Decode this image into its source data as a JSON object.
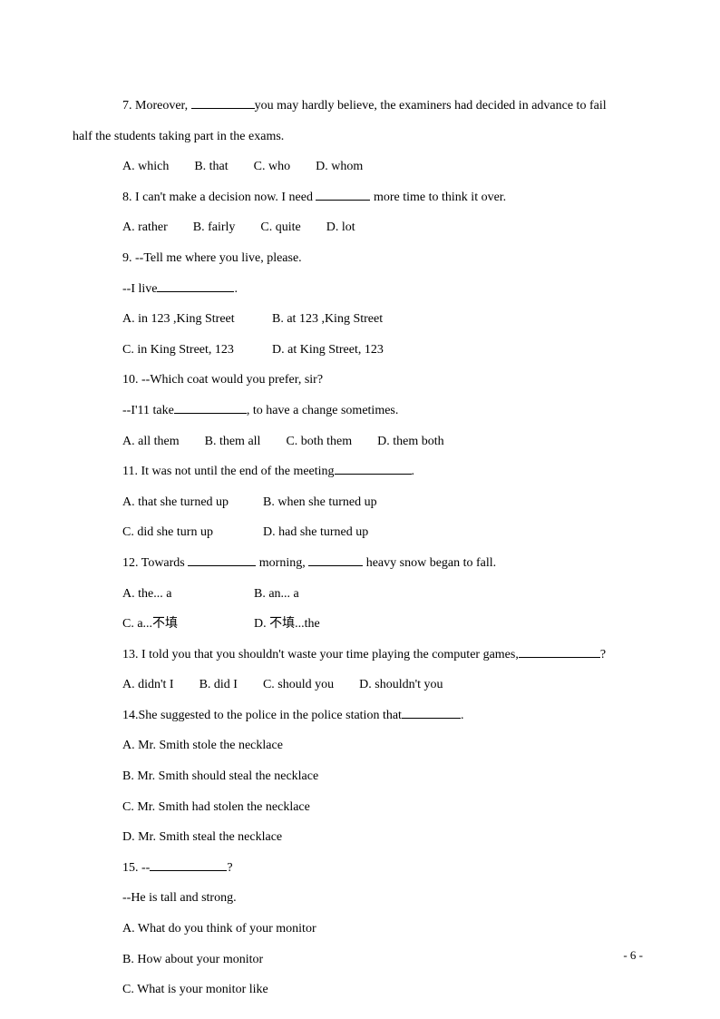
{
  "q7": {
    "pre": "7. Moreover, ",
    "post": "you may hardly believe, the examiners had decided in advance to fail",
    "cont": "half the students taking part in the exams.",
    "a": "A. which",
    "b": "B. that",
    "c": "C. who",
    "d": "D. whom"
  },
  "q8": {
    "pre": "8. I can't make a decision now. I need ",
    "post": " more time to think it over.",
    "a": "A. rather",
    "b": "B. fairly",
    "c": "C. quite",
    "d": "D. lot"
  },
  "q9": {
    "line1": "9. --Tell me where you live, please.",
    "line2": "--I live",
    "dot": ".",
    "a": "A. in 123 ,King Street",
    "b": "B. at 123 ,King Street",
    "c": "C. in King Street, 123",
    "d": "D. at King Street, 123"
  },
  "q10": {
    "line1": "10. --Which coat would you prefer, sir?",
    "pre": "--I'11 take",
    "post": ", to have a change sometimes.",
    "a": "A. all them",
    "b": "B. them all",
    "c": "C. both them",
    "d": "D. them both"
  },
  "q11": {
    "pre": "11. It was not until the end of the meeting",
    "dot": ".",
    "a": "A. that she turned up",
    "b": "B. when she turned up",
    "c": "C. did she turn up",
    "d": "D. had she turned up"
  },
  "q12": {
    "pre": "12. Towards ",
    "mid": " morning, ",
    "post": " heavy snow began to fall.",
    "a": "A. the... a",
    "b": "B. an... a",
    "c": "C. a...不填",
    "d": "D. 不填...the"
  },
  "q13": {
    "pre": "13. I told you that you shouldn't waste your time playing the computer games,",
    "post": "?",
    "a": "A. didn't I",
    "b": "B. did I",
    "c": "C. should you",
    "d": "D. shouldn't you"
  },
  "q14": {
    "pre": "14.She suggested to the police in the police station that",
    "dot": ".",
    "a": "A. Mr. Smith stole the necklace",
    "b": "B. Mr. Smith should steal the necklace",
    "c": "C. Mr. Smith had stolen the necklace",
    "d": "D. Mr. Smith steal the necklace"
  },
  "q15": {
    "pre": "15. --",
    "post": "?",
    "line2": "--He is tall and strong.",
    "a": "A. What do you think of your monitor",
    "b": "B. How about your monitor",
    "c": "C. What is your monitor like"
  },
  "page": "- 6 -"
}
